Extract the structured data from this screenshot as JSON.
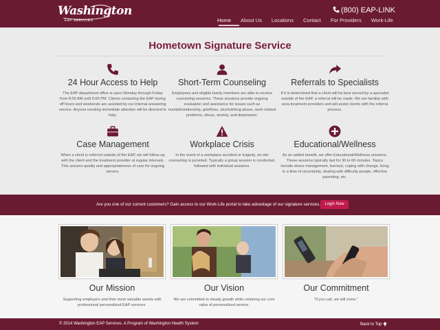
{
  "header": {
    "logo_main": "Washington",
    "logo_sub": "EAP SERVICES",
    "phone": "(800) EAP-LINK",
    "nav": [
      "Home",
      "About Us",
      "Locations",
      "Contact",
      "For Providers",
      "Work-Life"
    ]
  },
  "main": {
    "title": "Hometown Signature Service",
    "features": [
      {
        "icon": "phone-icon",
        "title": "24 Hour Access to Help",
        "text": "The EAP department office is open Monday through Friday from 8:00 AM until 5:00 PM. Clients contacting the EAP during off hours and weekends are assisted by our internal answering service. Anyone needing immediate attention will be directed to help."
      },
      {
        "icon": "user-icon",
        "title": "Short-Term Counseling",
        "text": "Employees and eligible family members are able to receive counseling sessions. These sessions provide ongoing evaluation and assistance for issues such as marital/relationship, grief/loss, alcohol/drug abuse, work related problems, stress, anxiety, and depression."
      },
      {
        "icon": "share-arrow-icon",
        "title": "Referrals to Specialists",
        "text": "If it is determined that a client will be best served by a specialist outside of the EAP, a referral will be made. We are familiar with area treatment providers and will assist clients with the referral process."
      },
      {
        "icon": "briefcase-icon",
        "title": "Case Management",
        "text": "When a client is referred outside of the EAP, we will follow-up with the client and the treatment provider at regular intervals. This assures quality and appropriateness of care for ongoing service."
      },
      {
        "icon": "warning-icon",
        "title": "Workplace Crisis",
        "text": "In the event of a workplace accident or tragedy, on-site counseling is provided. Typically a group session is conducted, followed with individual sessions."
      },
      {
        "icon": "plus-circle-icon",
        "title": "Educational/Wellness",
        "text": "As an added benefit, we offer Educational/Wellness sessions. These sessions typically last for 30 to 60 minutes. Topics include stress management, burnout, coping with change, living in a time of uncertainty, dealing with difficulty people, effective parenting, etc."
      }
    ]
  },
  "banner": {
    "text": "Are you one of our current customers? Gain access to our Work-Life portal to take advantage of our signature services.",
    "button": "Login Now"
  },
  "cards": [
    {
      "title": "Our Mission",
      "text": "Supporting employers and their most valuable assets with professional personalized EAP services."
    },
    {
      "title": "Our Vision",
      "text": "We are committed to steady growth while retaining our core value of personalized service."
    },
    {
      "title": "Our Commitment",
      "text": "\"If you call, we will come.\""
    }
  ],
  "footer": {
    "copyright": "© 2014 Washington EAP Services. A Program of Washington Health System",
    "back_to_top": "Back to Top"
  },
  "colors": {
    "brand": "#6b1a33",
    "accent": "#c21a4c",
    "title": "#7a1d3a"
  }
}
